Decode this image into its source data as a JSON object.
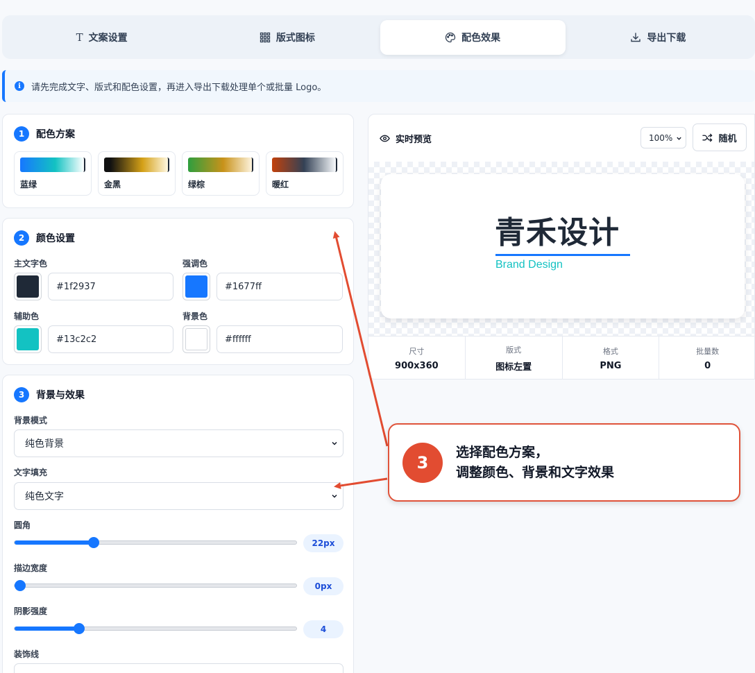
{
  "tabs": [
    {
      "label": "文案设置",
      "icon": "text-icon"
    },
    {
      "label": "版式图标",
      "icon": "grid-icon"
    },
    {
      "label": "配色效果",
      "icon": "palette-icon"
    },
    {
      "label": "导出下载",
      "icon": "download-icon"
    }
  ],
  "active_tab": "配色效果",
  "notice": {
    "icon": "info-icon",
    "text": "请先完成文字、版式和配色设置，再进入导出下载处理单个或批量 Logo。"
  },
  "section_scheme": {
    "number": "1",
    "title": "配色方案",
    "schemes": [
      {
        "name": "蓝绿",
        "colors": [
          "#1677ff",
          "#13c2c2",
          "#ffffff"
        ]
      },
      {
        "name": "金黑",
        "colors": [
          "#111111",
          "#d4a017",
          "#fff8e1"
        ]
      },
      {
        "name": "绿棕",
        "colors": [
          "#2e9e3e",
          "#c8921a",
          "#fdf3dd"
        ]
      },
      {
        "name": "暖红",
        "colors": [
          "#c2410c",
          "#334155",
          "#f8fafc"
        ]
      }
    ]
  },
  "section_colors": {
    "number": "2",
    "title": "颜色设置",
    "primary": {
      "label": "主文字色",
      "value": "#1f2937"
    },
    "accent": {
      "label": "强调色",
      "value": "#1677ff"
    },
    "secondary": {
      "label": "辅助色",
      "value": "#13c2c2"
    },
    "background": {
      "label": "背景色",
      "value": "#ffffff"
    }
  },
  "section_effects": {
    "number": "3",
    "title": "背景与效果",
    "bg_mode": {
      "label": "背景模式",
      "value": "纯色背景"
    },
    "text_fill": {
      "label": "文字填充",
      "value": "纯色文字"
    },
    "radius": {
      "label": "圆角",
      "value": "22px",
      "fraction": 0.28
    },
    "stroke": {
      "label": "描边宽度",
      "value": "0px",
      "fraction": 0.0
    },
    "shadow": {
      "label": "阴影强度",
      "value": "4",
      "fraction": 0.23
    },
    "decor_line": {
      "label": "装饰线"
    }
  },
  "preview": {
    "title": "实时预览",
    "zoom": "100%",
    "random_label": "随机",
    "logo_main": "青禾设计",
    "logo_sub": "Brand Design",
    "stats": [
      {
        "label": "尺寸",
        "value": "900x360"
      },
      {
        "label": "版式",
        "value": "图标左置"
      },
      {
        "label": "格式",
        "value": "PNG"
      },
      {
        "label": "批量数",
        "value": "0"
      }
    ]
  },
  "callout": {
    "number": "3",
    "line1": "选择配色方案，",
    "line2": "调整颜色、背景和文字效果"
  },
  "colors": {
    "accent": "#1677ff",
    "callout": "#e24c31"
  }
}
